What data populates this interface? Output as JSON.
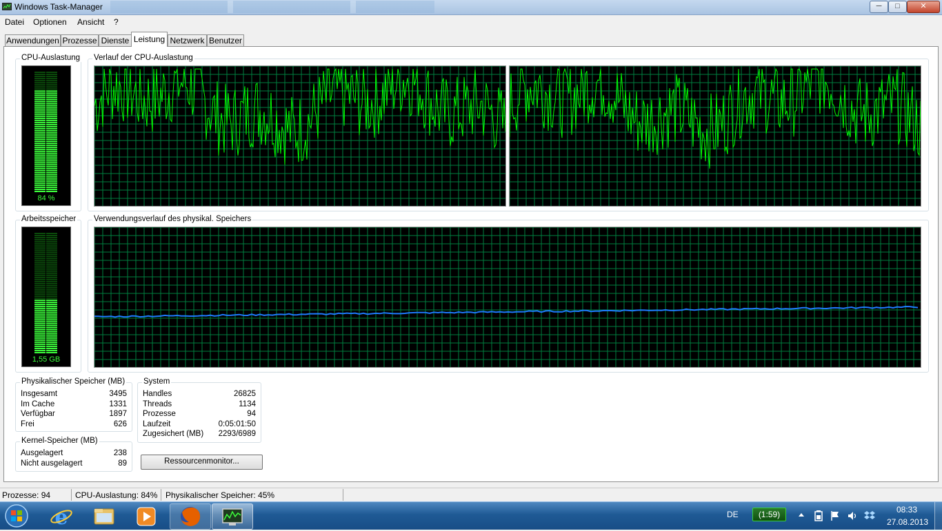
{
  "window": {
    "title": "Windows Task-Manager",
    "min_symbol": "─",
    "max_symbol": "□",
    "close_symbol": "✕"
  },
  "menu": [
    "Datei",
    "Optionen",
    "Ansicht",
    "?"
  ],
  "tabs": [
    "Anwendungen",
    "Prozesse",
    "Dienste",
    "Leistung",
    "Netzwerk",
    "Benutzer"
  ],
  "active_tab": "Leistung",
  "cpu": {
    "meter_label": "CPU-Auslastung",
    "meter_value": "84 %",
    "usage_fraction": 0.84,
    "history_label": "Verlauf der CPU-Auslastung",
    "core_count": 2
  },
  "memory": {
    "meter_label": "Arbeitsspeicher",
    "meter_value": "1,55 GB",
    "usage_fraction": 0.45,
    "history_label": "Verwendungsverlauf des physikal. Speichers",
    "line_color": "#1e7bff"
  },
  "physical_memory": {
    "label": "Physikalischer Speicher (MB)",
    "rows": [
      {
        "key": "Insgesamt",
        "value": "3495"
      },
      {
        "key": "Im Cache",
        "value": "1331"
      },
      {
        "key": "Verfügbar",
        "value": "1897"
      },
      {
        "key": "Frei",
        "value": "626"
      }
    ]
  },
  "kernel_memory": {
    "label": "Kernel-Speicher (MB)",
    "rows": [
      {
        "key": "Ausgelagert",
        "value": "238"
      },
      {
        "key": "Nicht ausgelagert",
        "value": "89"
      }
    ]
  },
  "system": {
    "label": "System",
    "rows": [
      {
        "key": "Handles",
        "value": "26825"
      },
      {
        "key": "Threads",
        "value": "1134"
      },
      {
        "key": "Prozesse",
        "value": "94"
      },
      {
        "key": "Laufzeit",
        "value": "0:05:01:50"
      },
      {
        "key": "Zugesichert (MB)",
        "value": "2293/6989"
      }
    ]
  },
  "resource_monitor_button": "Ressourcenmonitor...",
  "status": {
    "processes": "Prozesse: 94",
    "cpu": "CPU-Auslastung: 84%",
    "memory": "Physikalischer Speicher: 45%"
  },
  "taskbar": {
    "apps": [
      "start-orb-icon",
      "internet-explorer-icon",
      "explorer-folder-icon",
      "media-player-icon",
      "firefox-icon",
      "task-manager-icon"
    ],
    "language": "DE",
    "battery": "(1:59)",
    "time": "08:33",
    "date": "27.08.2013"
  },
  "colors": {
    "graph_grid": "#008040",
    "graph_line": "#00ff00",
    "graph_bg": "#000000",
    "meter_green": "#3cff3c"
  }
}
